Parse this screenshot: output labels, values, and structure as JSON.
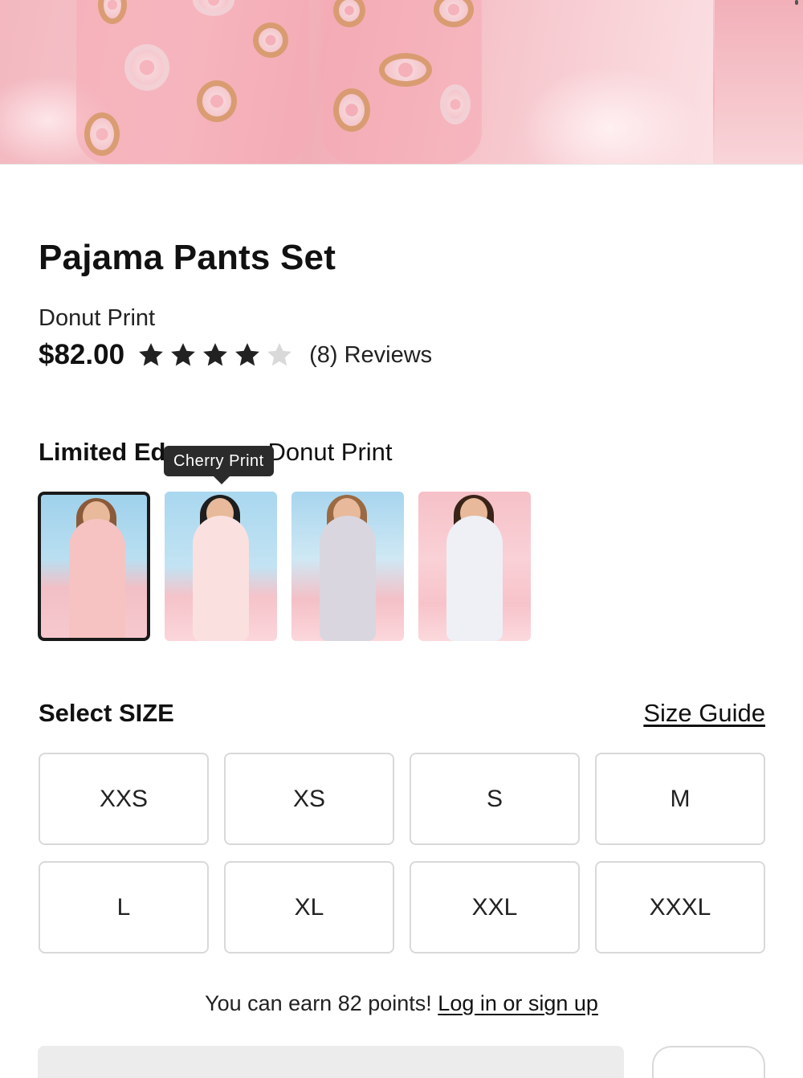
{
  "product": {
    "title": "Pajama Pants Set",
    "variant": "Donut Print",
    "price": "$82.00",
    "rating": 4,
    "rating_max": 5,
    "reviews_label": "(8) Reviews"
  },
  "colors": {
    "star_filled": "#222222",
    "star_empty": "#d9d9d9",
    "tooltip_bg": "#2b2b2b"
  },
  "edition": {
    "label_bold": "Limited Ed",
    "label_rest": "Donut Print",
    "tooltip": "Cherry Print"
  },
  "size": {
    "heading": "Select SIZE",
    "guide_link": "Size Guide",
    "options": [
      "XXS",
      "XS",
      "S",
      "M",
      "L",
      "XL",
      "XXL",
      "XXXL"
    ]
  },
  "points": {
    "text": "You can earn 82 points! ",
    "link": "Log in or sign up"
  }
}
